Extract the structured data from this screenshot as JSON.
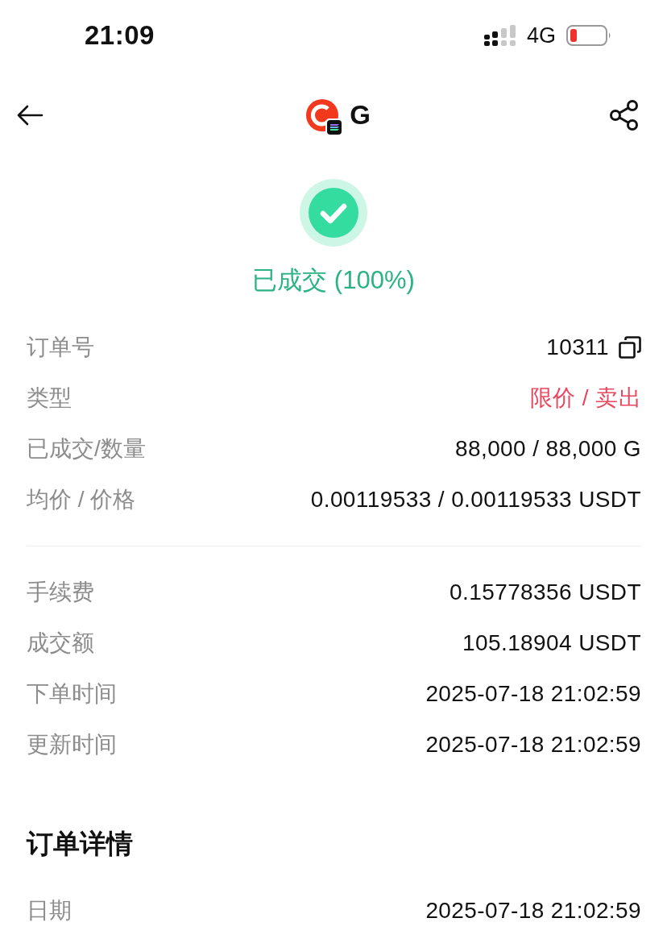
{
  "status_bar": {
    "time": "21:09",
    "network": "4G"
  },
  "header": {
    "coin": "G"
  },
  "order_status": {
    "kind": "filled",
    "text": "已成交 (100%)"
  },
  "summary_groups": [
    {
      "rows": [
        {
          "label": "订单号",
          "value": "10311",
          "kind": "copyable"
        },
        {
          "label": "类型",
          "value": "限价 / 卖出",
          "kind": "sell"
        },
        {
          "label": "已成交/数量",
          "value": "88,000 / 88,000 G",
          "kind": "text"
        },
        {
          "label": "均价 / 价格",
          "value": "0.00119533 / 0.00119533 USDT",
          "kind": "text"
        }
      ]
    },
    {
      "rows": [
        {
          "label": "手续费",
          "value": "0.15778356 USDT",
          "kind": "text"
        },
        {
          "label": "成交额",
          "value": "105.18904 USDT",
          "kind": "text"
        },
        {
          "label": "下单时间",
          "value": "2025-07-18 21:02:59",
          "kind": "text"
        },
        {
          "label": "更新时间",
          "value": "2025-07-18 21:02:59",
          "kind": "text"
        }
      ]
    }
  ],
  "details": {
    "title": "订单详情",
    "rows": [
      {
        "label": "日期",
        "value": "2025-07-18 21:02:59",
        "kind": "text"
      }
    ]
  }
}
